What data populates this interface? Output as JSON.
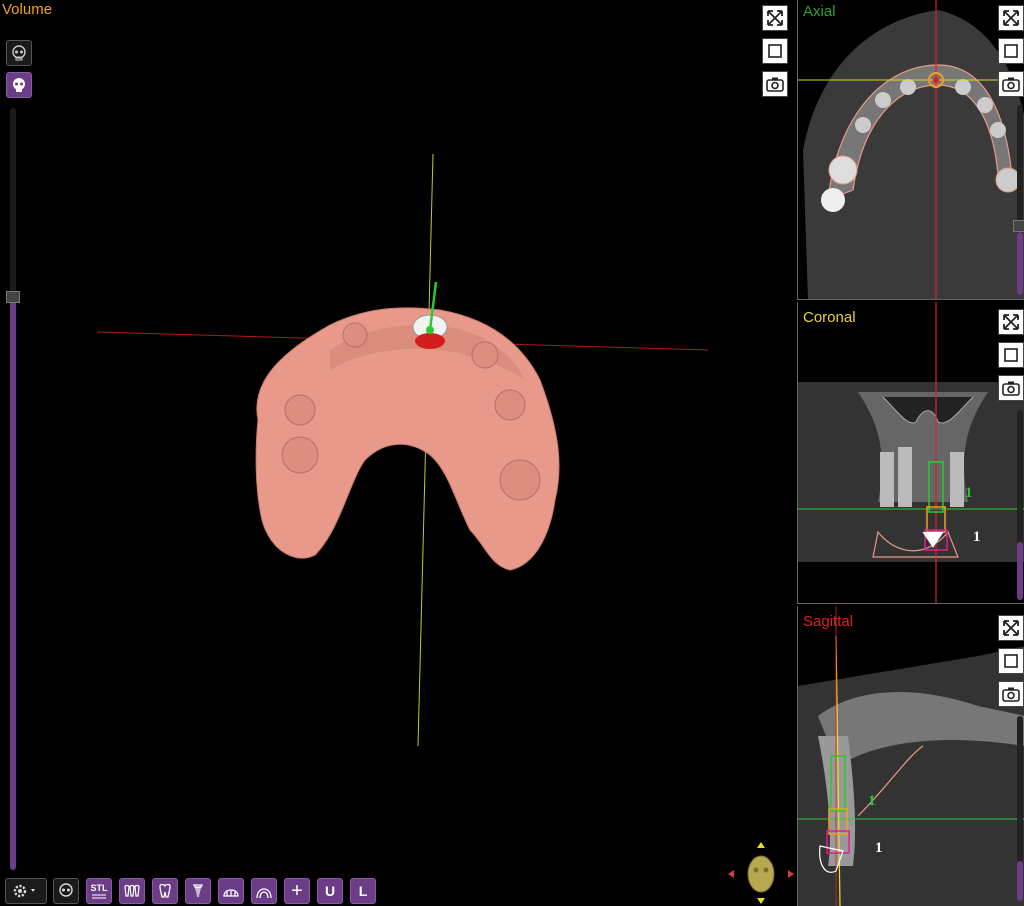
{
  "volume_view": {
    "title": "Volume",
    "icons": [
      "skull-outline-icon",
      "skull-solid-icon"
    ],
    "opacity_level": 0.65
  },
  "axial": {
    "title": "Axial",
    "color": "#2ea02e"
  },
  "coronal": {
    "title": "Coronal",
    "color": "#e8d23c",
    "implant_label_a": "1",
    "implant_label_b": "1"
  },
  "sagittal": {
    "title": "Sagittal",
    "color": "#e02020",
    "implant_label_a": "1",
    "implant_label_b": "1"
  },
  "toolbar": {
    "stl_label": "STL",
    "plus_label": "+",
    "upper_label": "U",
    "lower_label": "L",
    "icons": [
      "settings-gear-icon",
      "skull-icon",
      "stl-icon",
      "teeth-scan-icon",
      "tooth-icon",
      "implant-icon",
      "crown-icon",
      "arch-icon",
      "add-icon",
      "upper-jaw-icon",
      "lower-jaw-icon"
    ]
  },
  "colors": {
    "accent_purple": "#6a3d86",
    "model_color": "#e8998a",
    "volume_title": "#f0a020"
  }
}
